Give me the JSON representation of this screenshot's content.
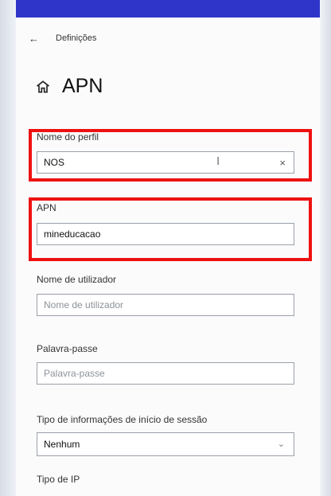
{
  "header": {
    "back_icon": "back-arrow-icon",
    "app_title": "Definições",
    "page_title": "APN"
  },
  "fields": {
    "profile_name": {
      "label": "Nome do perfil",
      "value": "NOS"
    },
    "apn": {
      "label": "APN",
      "value": "mineducacao"
    },
    "username": {
      "label": "Nome de utilizador",
      "placeholder": "Nome de utilizador"
    },
    "password": {
      "label": "Palavra-passe",
      "placeholder": "Palavra-passe"
    },
    "sign_in_info_type": {
      "label": "Tipo de informações de início de sessão",
      "selected": "Nenhum"
    },
    "ip_type": {
      "label": "Tipo de IP"
    }
  },
  "colors": {
    "highlight": "#ee1111",
    "top_border": "#2f35c9"
  }
}
